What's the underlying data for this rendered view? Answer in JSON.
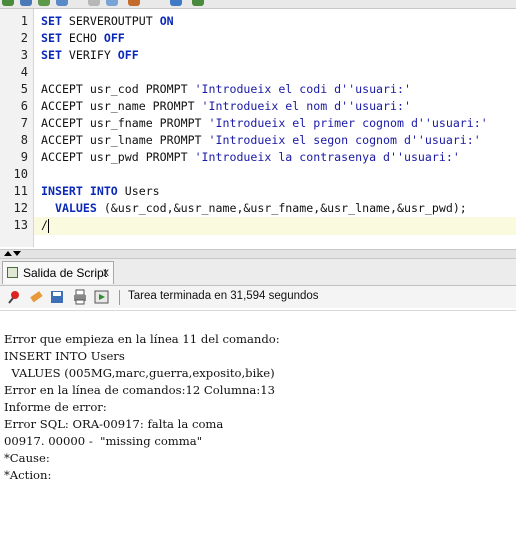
{
  "toolbar": {
    "icons": [
      "run-icon",
      "save-icon",
      "undo-icon",
      "redo-icon",
      "cut-icon",
      "copy-icon",
      "paste-icon",
      "autotrace-icon",
      "clear-icon"
    ]
  },
  "editor": {
    "line_numbers": [
      "1",
      "2",
      "3",
      "4",
      "5",
      "6",
      "7",
      "8",
      "9",
      "10",
      "11",
      "12",
      "13"
    ],
    "lines": [
      [
        {
          "t": "SET",
          "c": "kw"
        },
        {
          "t": " SERVEROUTPUT ",
          "c": ""
        },
        {
          "t": "ON",
          "c": "kw"
        }
      ],
      [
        {
          "t": "SET",
          "c": "kw"
        },
        {
          "t": " ECHO ",
          "c": ""
        },
        {
          "t": "OFF",
          "c": "kw"
        }
      ],
      [
        {
          "t": "SET",
          "c": "kw"
        },
        {
          "t": " VERIFY ",
          "c": ""
        },
        {
          "t": "OFF",
          "c": "kw"
        }
      ],
      [],
      [
        {
          "t": "ACCEPT usr_cod PROMPT ",
          "c": ""
        },
        {
          "t": "'Introdueix el codi d''usuari:'",
          "c": "str"
        }
      ],
      [
        {
          "t": "ACCEPT usr_name PROMPT ",
          "c": ""
        },
        {
          "t": "'Introdueix el nom d''usuari:'",
          "c": "str"
        }
      ],
      [
        {
          "t": "ACCEPT usr_fname PROMPT ",
          "c": ""
        },
        {
          "t": "'Introdueix el primer cognom d''usuari:'",
          "c": "str"
        }
      ],
      [
        {
          "t": "ACCEPT usr_lname PROMPT ",
          "c": ""
        },
        {
          "t": "'Introdueix el segon cognom d''usuari:'",
          "c": "str"
        }
      ],
      [
        {
          "t": "ACCEPT usr_pwd PROMPT ",
          "c": ""
        },
        {
          "t": "'Introdueix la contrasenya d''usuari:'",
          "c": "str"
        }
      ],
      [],
      [
        {
          "t": "INSERT INTO",
          "c": "kw"
        },
        {
          "t": " Users",
          "c": ""
        }
      ],
      [
        {
          "t": "  VALUES",
          "c": "kw"
        },
        {
          "t": " (&usr_cod,&usr_name,&usr_fname,&usr_lname,&usr_pwd);",
          "c": ""
        }
      ],
      [
        {
          "t": "/",
          "c": ""
        }
      ]
    ]
  },
  "output_panel": {
    "tab_label": "Salida de Script",
    "tab_close": "x",
    "status_text": "Tarea terminada en 31,594 segundos",
    "lines": [
      "Error que empieza en la línea 11 del comando:",
      "INSERT INTO Users",
      "  VALUES (005MG,marc,guerra,exposito,bike)",
      "Error en la línea de comandos:12 Columna:13",
      "Informe de error:",
      "Error SQL: ORA-00917: falta la coma",
      "00917. 00000 -  \"missing comma\"",
      "*Cause:",
      "*Action:"
    ]
  }
}
